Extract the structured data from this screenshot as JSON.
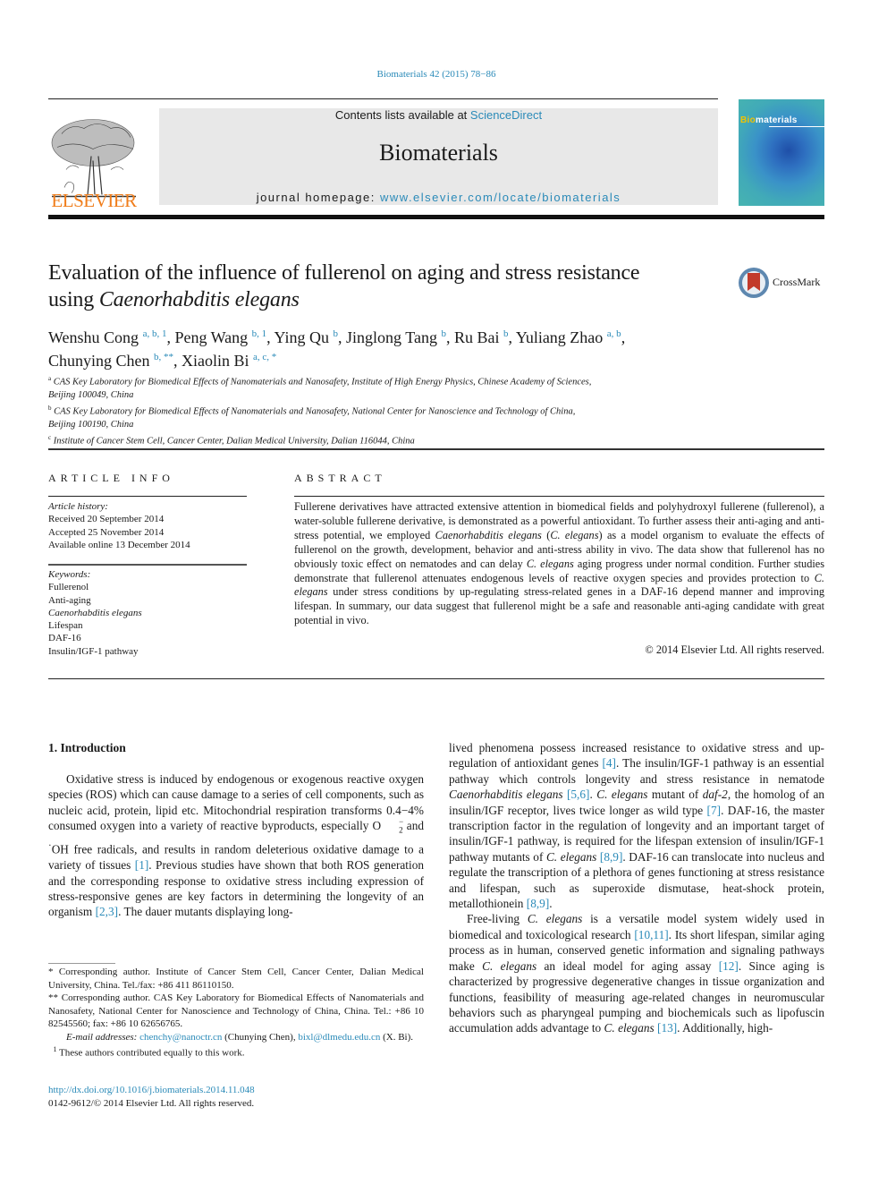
{
  "header": {
    "citation": "Biomaterials 42 (2015) 78−86",
    "publisher_logo_text": "ELSEVIER",
    "contents_prefix": "Contents lists available at ",
    "contents_link": "ScienceDirect",
    "journal_name": "Biomaterials",
    "homepage_prefix": "journal homepage: ",
    "homepage_link": "www.elsevier.com/locate/biomaterials",
    "cover_title_bio": "Bio",
    "cover_title_rest": "materials",
    "crossmark_label": "CrossMark"
  },
  "article": {
    "title_line1": "Evaluation of the influence of fullerenol on aging and stress resistance",
    "title_line2_prefix": "using ",
    "title_line2_italic": "Caenorhabditis elegans",
    "authors": [
      {
        "name": "Wenshu Cong",
        "aff": "a, b, 1",
        "sep": ", "
      },
      {
        "name": "Peng Wang",
        "aff": "b, 1",
        "sep": ", "
      },
      {
        "name": "Ying Qu",
        "aff": "b",
        "sep": ", "
      },
      {
        "name": "Jinglong Tang",
        "aff": "b",
        "sep": ", "
      },
      {
        "name": "Ru Bai",
        "aff": "b",
        "sep": ", "
      },
      {
        "name": "Yuliang Zhao",
        "aff": "a, b",
        "sep": ","
      },
      {
        "name": "Chunying Chen",
        "aff": "b, **",
        "sep": ", "
      },
      {
        "name": "Xiaolin Bi",
        "aff": "a, c, *",
        "sep": ""
      }
    ],
    "affiliations": [
      {
        "label": "a",
        "line1": "CAS Key Laboratory for Biomedical Effects of Nanomaterials and Nanosafety, Institute of High Energy Physics, Chinese Academy of Sciences,",
        "line2": "Beijing 100049, China"
      },
      {
        "label": "b",
        "line1": "CAS Key Laboratory for Biomedical Effects of Nanomaterials and Nanosafety, National Center for Nanoscience and Technology of China,",
        "line2": "Beijing 100190, China"
      },
      {
        "label": "c",
        "line1": "Institute of Cancer Stem Cell, Cancer Center, Dalian Medical University, Dalian 116044, China",
        "line2": ""
      }
    ]
  },
  "article_info": {
    "heading": "ARTICLE INFO",
    "history_label": "Article history:",
    "received": "Received 20 September 2014",
    "accepted": "Accepted 25 November 2014",
    "online": "Available online 13 December 2014",
    "keywords_label": "Keywords:",
    "keywords": [
      "Fullerenol",
      "Anti-aging",
      "Caenorhabditis elegans",
      "Lifespan",
      "DAF-16",
      "Insulin/IGF-1 pathway"
    ]
  },
  "abstract": {
    "heading": "ABSTRACT",
    "p1": "Fullerene derivatives have attracted extensive attention in biomedical fields and polyhydroxyl fullerene (fullerenol), a water-soluble fullerene derivative, is demonstrated as a powerful antioxidant. To further assess their anti-aging and anti-stress potential, we employed ",
    "i1": "Caenorhabditis elegans",
    "p2": " (",
    "i2": "C. elegans",
    "p3": ") as a model organism to evaluate the effects of fullerenol on the growth, development, behavior and anti-stress ability in vivo. The data show that fullerenol has no obviously toxic effect on nematodes and can delay ",
    "i3": "C. elegans",
    "p4": " aging progress under normal condition. Further studies demonstrate that fullerenol attenuates endogenous levels of reactive oxygen species and provides protection to ",
    "i4": "C. elegans",
    "p5": " under stress conditions by up-regulating stress-related genes in a DAF-16 depend manner and improving lifespan. In summary, our data suggest that fullerenol might be a safe and reasonable anti-aging candidate with great potential in vivo.",
    "copyright": "© 2014 Elsevier Ltd. All rights reserved."
  },
  "introduction": {
    "heading": "1.  Introduction",
    "left": {
      "t1": "Oxidative stress is induced by endogenous or exogenous reactive oxygen species (ROS) which can cause damage to a series of cell components, such as nucleic acid, protein, lipid etc. Mitochondrial respiration transforms 0.4−4% consumed oxygen into a variety of reactive byproducts, especially O",
      "t1_sub": "2",
      "t1_sup": "−",
      "t2": " and ",
      "t2_dot": "·",
      "t3": "OH free radicals, and results in random deleterious oxidative damage to a variety of tissues ",
      "r1": "[1]",
      "t4": ". Previous studies have shown that both ROS generation and the corresponding response to oxidative stress including expression of stress-responsive genes are key factors in determining the longevity of an organism ",
      "r2": "[2,3]",
      "t5": ". The dauer mutants displaying long-"
    },
    "right": {
      "p1_a": "lived phenomena possess increased resistance to oxidative stress and up-regulation of antioxidant genes ",
      "p1_r1": "[4]",
      "p1_b": ". The insulin/IGF-1 pathway is an essential pathway which controls longevity and stress resistance in nematode ",
      "p1_i1": "Caenorhabditis elegans",
      "p1_c": " ",
      "p1_r2": "[5,6]",
      "p1_d": ". ",
      "p1_i2": "C. elegans",
      "p1_e": " mutant of ",
      "p1_i3": "daf-2",
      "p1_f": ", the homolog of an insulin/IGF receptor, lives twice longer as wild type ",
      "p1_r3": "[7]",
      "p1_g": ". DAF-16, the master transcription factor in the regulation of longevity and an important target of insulin/IGF-1 pathway, is required for the lifespan extension of insulin/IGF-1 pathway mutants of ",
      "p1_i4": "C. elegans",
      "p1_h": " ",
      "p1_r4": "[8,9]",
      "p1_j": ". DAF-16 can translocate into nucleus and regulate the transcription of a plethora of genes functioning at stress resistance and lifespan, such as superoxide dismutase, heat-shock protein, metallothionein ",
      "p1_r5": "[8,9]",
      "p1_k": ".",
      "p2_a": "Free-living ",
      "p2_i1": "C. elegans",
      "p2_b": " is a versatile model system widely used in biomedical and toxicological research ",
      "p2_r1": "[10,11]",
      "p2_c": ". Its short lifespan, similar aging process as in human, conserved genetic information and signaling pathways make ",
      "p2_i2": "C. elegans",
      "p2_d": " an ideal model for aging assay ",
      "p2_r2": "[12]",
      "p2_e": ". Since aging is characterized by progressive degenerative changes in tissue organization and functions, feasibility of measuring age-related changes in neuromuscular behaviors such as pharyngeal pumping and biochemicals such as lipofuscin accumulation adds advantage to ",
      "p2_i3": "C. elegans",
      "p2_f": " ",
      "p2_r3": "[13]",
      "p2_g": ". Additionally, high-"
    }
  },
  "footnotes": {
    "fn1": " * Corresponding author. Institute of Cancer Stem Cell, Cancer Center, Dalian Medical University, China. Tel./fax: +86 411 86110150.",
    "fn2": " ** Corresponding author. CAS Key Laboratory for Biomedical Effects of Nanomaterials and Nanosafety, National Center for Nanoscience and Technology of China, China. Tel.: +86 10 82545560; fax: +86 10 62656765.",
    "email_label": "E-mail addresses:",
    "email1": "chenchy@nanoctr.cn",
    "email1_name": " (Chunying Chen), ",
    "email2": "bixl@dlmedu.edu.cn",
    "email2_name": " (X. Bi).",
    "fn3_mark": "1",
    "fn3": " These authors contributed equally to this work.",
    "doi": "http://dx.doi.org/10.1016/j.biomaterials.2014.11.048",
    "issn": "0142-9612/© 2014 Elsevier Ltd. All rights reserved."
  }
}
